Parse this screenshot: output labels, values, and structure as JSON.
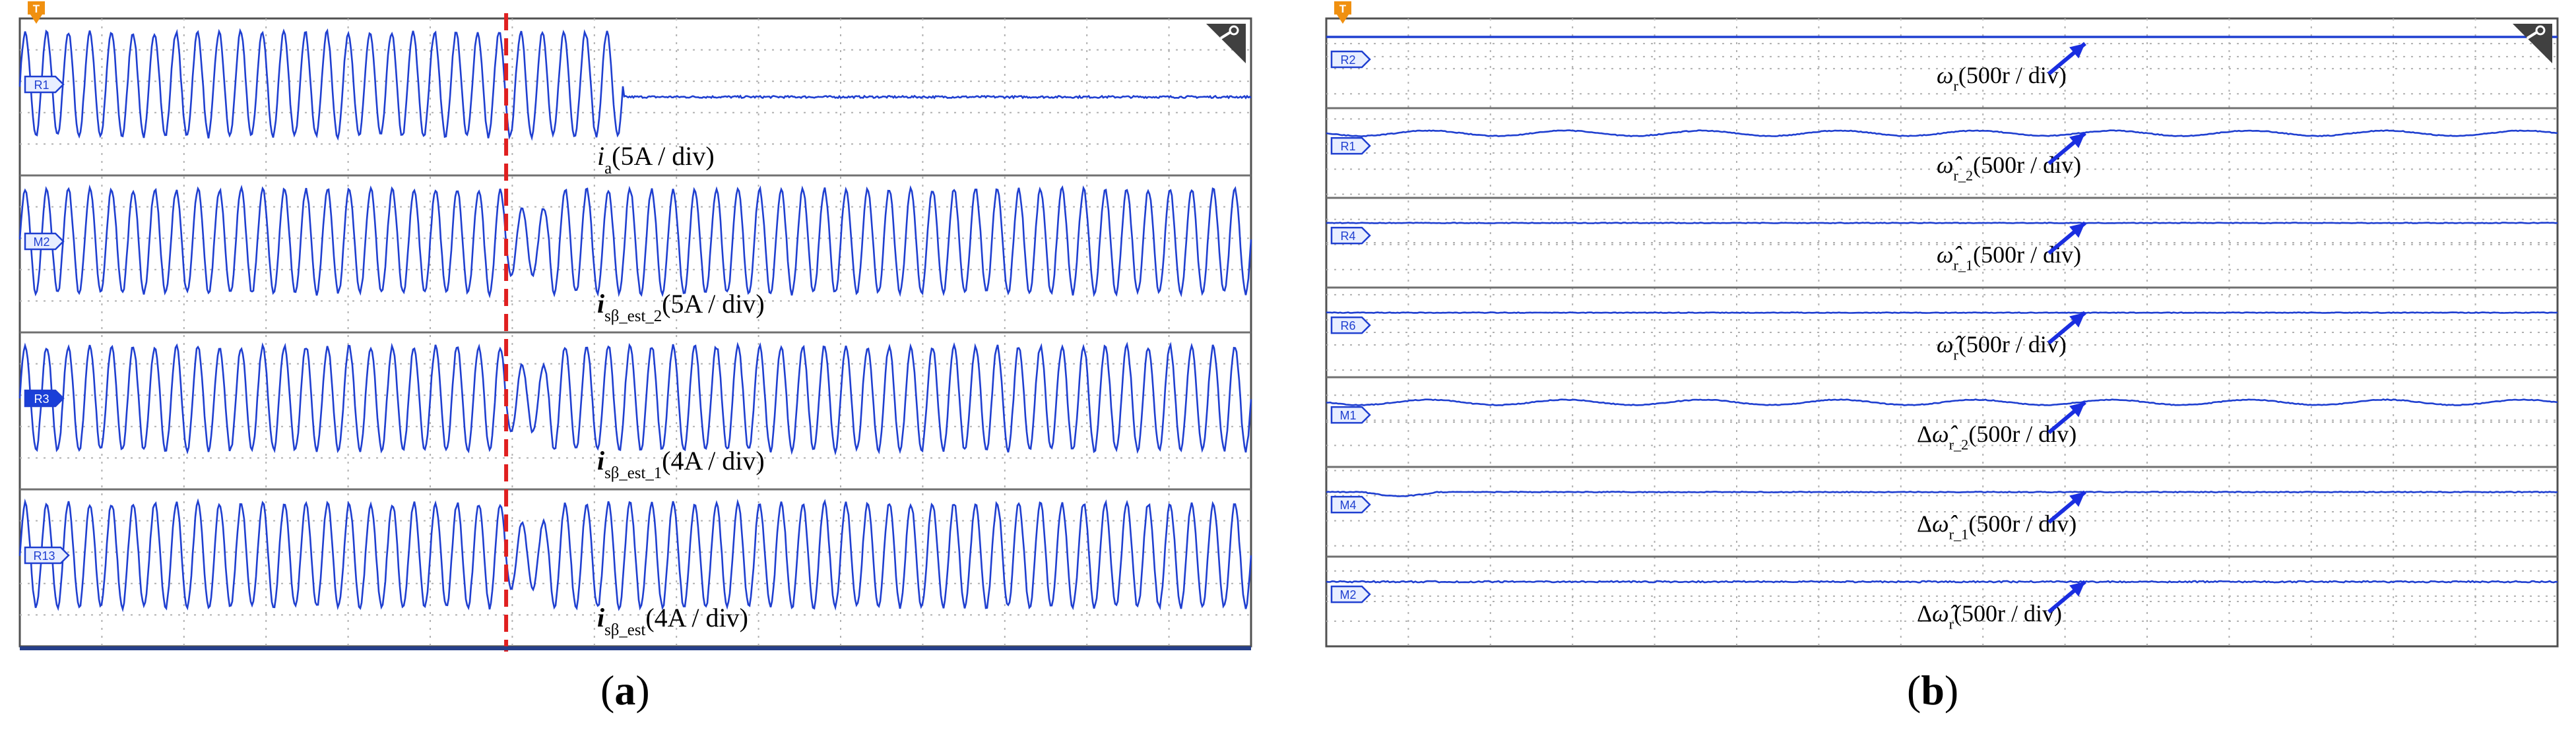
{
  "colors": {
    "trace": "#1f3fd0",
    "trigger_cursor": "#e02020",
    "grid": "#b0b0b0",
    "divider": "#707070",
    "frame": "#505050",
    "marker_fill": "#e8eeff",
    "marker_selected": "#1a3fd8",
    "trigger_icon": "#f09010",
    "corner_icon": "#404040",
    "arrow": "#1a2ee0"
  },
  "panel_a": {
    "caption_letter": "a",
    "trigger_label": "T",
    "channels": [
      {
        "marker": "R1",
        "label_main": "i",
        "label_sub": "a",
        "label_rest": "(5A / div)",
        "selected": false
      },
      {
        "marker": "M2",
        "label_main": "i",
        "label_sub": "sβ_est_2",
        "label_rest": "(5A / div)",
        "selected": false
      },
      {
        "marker": "R3",
        "label_main": "i",
        "label_sub": "sβ_est_1",
        "label_rest": "(4A / div)",
        "selected": true
      },
      {
        "marker": "R13",
        "label_main": "i",
        "label_sub": "sβ_est",
        "label_rest": "(4A / div)",
        "selected": false
      }
    ]
  },
  "panel_b": {
    "caption_letter": "b",
    "trigger_label": "T",
    "channels": [
      {
        "marker": "R2",
        "label_prefix": "",
        "label_main": "ω",
        "label_sub": "r",
        "label_rest": "(500r / div)"
      },
      {
        "marker": "R1",
        "label_prefix": "",
        "label_main": "ω̂",
        "label_sub": "r_2",
        "label_rest": "(500r / div)"
      },
      {
        "marker": "R4",
        "label_prefix": "",
        "label_main": "ω̂",
        "label_sub": "r_1",
        "label_rest": "(500r / div)"
      },
      {
        "marker": "R6",
        "label_prefix": "",
        "label_main": "ω̂",
        "label_sub": "r",
        "label_rest": "(500r / div)"
      },
      {
        "marker": "M1",
        "label_prefix": "Δ",
        "label_main": "ω̂",
        "label_sub": "r_2",
        "label_rest": "(500r / div)"
      },
      {
        "marker": "M4",
        "label_prefix": "Δ",
        "label_main": "ω̂",
        "label_sub": "r_1",
        "label_rest": "(500r / div)"
      },
      {
        "marker": "M2",
        "label_prefix": "Δ",
        "label_main": "ω̂",
        "label_sub": "r",
        "label_rest": "(500r / div)"
      }
    ]
  },
  "chart_data": [
    {
      "type": "line",
      "panel": "a",
      "grid": true,
      "description_of_traces": [
        {
          "name": "i_a",
          "waveform": "sinusoid",
          "cycles_shown": 28,
          "cycles_before_drop": 28,
          "drops_to_zero_at_fraction": 0.49
        },
        {
          "name": "i_sβ_est_2",
          "waveform": "sinusoid",
          "cycles_shown": 57
        },
        {
          "name": "i_sβ_est_1",
          "waveform": "sinusoid",
          "cycles_shown": 57
        },
        {
          "name": "i_sβ_est",
          "waveform": "sinusoid",
          "cycles_shown": 57
        }
      ],
      "trigger_cursor_fraction": 0.395
    },
    {
      "type": "line",
      "panel": "b",
      "grid": true,
      "description_of_traces": [
        {
          "name": "ω_r",
          "waveform": "flat"
        },
        {
          "name": "ω̂_r_2",
          "waveform": "flat_small_ripple"
        },
        {
          "name": "ω̂_r_1",
          "waveform": "flat"
        },
        {
          "name": "ω̂_r",
          "waveform": "flat"
        },
        {
          "name": "Δω̂_r_2",
          "waveform": "flat_small_ripple"
        },
        {
          "name": "Δω̂_r_1",
          "waveform": "flat_small_dip"
        },
        {
          "name": "Δω̂_r",
          "waveform": "flat_noise"
        }
      ]
    }
  ]
}
